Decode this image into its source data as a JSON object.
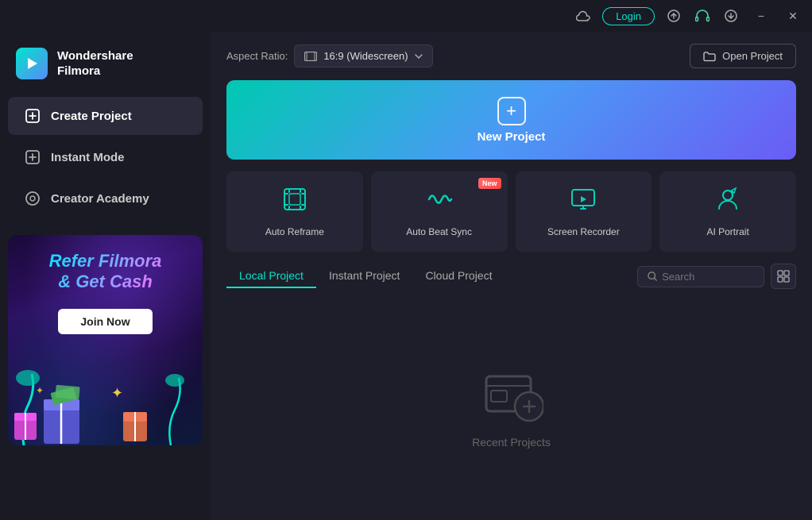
{
  "titlebar": {
    "login_label": "Login",
    "minimize_label": "−",
    "close_label": "✕"
  },
  "sidebar": {
    "logo_title": "Wondershare\nFilmora",
    "nav_items": [
      {
        "id": "create-project",
        "label": "Create Project",
        "active": true
      },
      {
        "id": "instant-mode",
        "label": "Instant Mode",
        "active": false
      },
      {
        "id": "creator-academy",
        "label": "Creator Academy",
        "active": false
      }
    ],
    "promo": {
      "title": "Refer Filmora\n& Get Cash",
      "button_label": "Join Now"
    }
  },
  "main": {
    "aspect_ratio": {
      "label": "Aspect Ratio:",
      "value": "16:9 (Widescreen)"
    },
    "open_project_label": "Open Project",
    "new_project_label": "New Project",
    "quick_actions": [
      {
        "id": "auto-reframe",
        "label": "Auto Reframe",
        "is_new": false
      },
      {
        "id": "auto-beat-sync",
        "label": "Auto Beat Sync",
        "is_new": true
      },
      {
        "id": "screen-recorder",
        "label": "Screen Recorder",
        "is_new": false
      },
      {
        "id": "ai-portrait",
        "label": "AI Portrait",
        "is_new": false
      }
    ],
    "new_badge": "New",
    "projects": {
      "tabs": [
        {
          "id": "local",
          "label": "Local Project",
          "active": true
        },
        {
          "id": "instant",
          "label": "Instant Project",
          "active": false
        },
        {
          "id": "cloud",
          "label": "Cloud Project",
          "active": false
        }
      ],
      "search_placeholder": "Search",
      "empty_label": "Recent Projects"
    }
  }
}
